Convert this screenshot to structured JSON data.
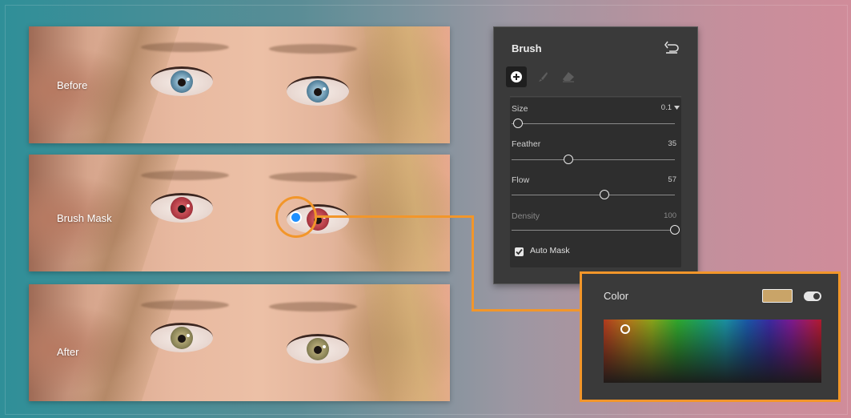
{
  "strips": [
    {
      "label": "Before",
      "iris": "blue"
    },
    {
      "label": "Brush Mask",
      "iris": "red"
    },
    {
      "label": "After",
      "iris": "hazel"
    }
  ],
  "brush_panel": {
    "title": "Brush",
    "tools": [
      "add-icon",
      "brush-icon",
      "eraser-icon"
    ],
    "sliders": [
      {
        "label": "Size",
        "value": "0.1",
        "has_dropdown": true,
        "fraction": 0.04
      },
      {
        "label": "Feather",
        "value": "35",
        "fraction": 0.35
      },
      {
        "label": "Flow",
        "value": "57",
        "fraction": 0.57
      },
      {
        "label": "Density",
        "value": "100",
        "fraction": 1.0,
        "dimmed": true
      }
    ],
    "auto_mask": {
      "label": "Auto Mask",
      "checked": true
    }
  },
  "color_panel": {
    "title": "Color",
    "swatch_color": "#c9a468",
    "toggle_on": true
  },
  "accent_color": "#f2962a"
}
